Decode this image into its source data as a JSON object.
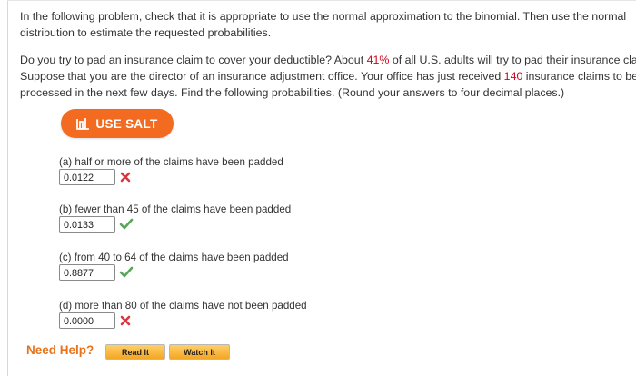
{
  "problem": {
    "intro_line1": "In the following problem, check that it is appropriate to use the normal approximation to the binomial. Then use the normal",
    "intro_line2": "distribution to estimate the requested probabilities.",
    "body_line1_a": "Do you try to pad an insurance claim to cover your deductible? About ",
    "body_line1_pct": "41%",
    "body_line1_b": " of all U.S. adults will try to pad their insurance cla",
    "body_line2_a": "Suppose that you are the director of an insurance adjustment office. Your office has just received ",
    "body_line2_num": "140",
    "body_line2_b": " insurance claims to be",
    "body_line3": "processed in the next few days. Find the following probabilities. (Round your answers to four decimal places.)"
  },
  "salt_button": {
    "label": "USE SALT"
  },
  "questions": [
    {
      "label": "(a) half or more of the claims have been padded",
      "answer": "0.0122",
      "status": "incorrect"
    },
    {
      "label": "(b) fewer than 45 of the claims have been padded",
      "answer": "0.0133",
      "status": "correct"
    },
    {
      "label": "(c) from 40 to 64 of the claims have been padded",
      "answer": "0.8877",
      "status": "correct"
    },
    {
      "label": "(d) more than 80 of the claims have not been padded",
      "answer": "0.0000",
      "status": "incorrect"
    }
  ],
  "help": {
    "need_help": "Need Help?",
    "read_it": "Read It",
    "watch_it": "Watch It"
  },
  "colors": {
    "highlight": "#d0021b",
    "salt": "#f26b21",
    "correct": "#5aa55a",
    "incorrect": "#d9363e",
    "need_help": "#e8731c"
  },
  "icons": {
    "salt": "salt-icon",
    "correct": "check-icon",
    "incorrect": "x-icon"
  }
}
